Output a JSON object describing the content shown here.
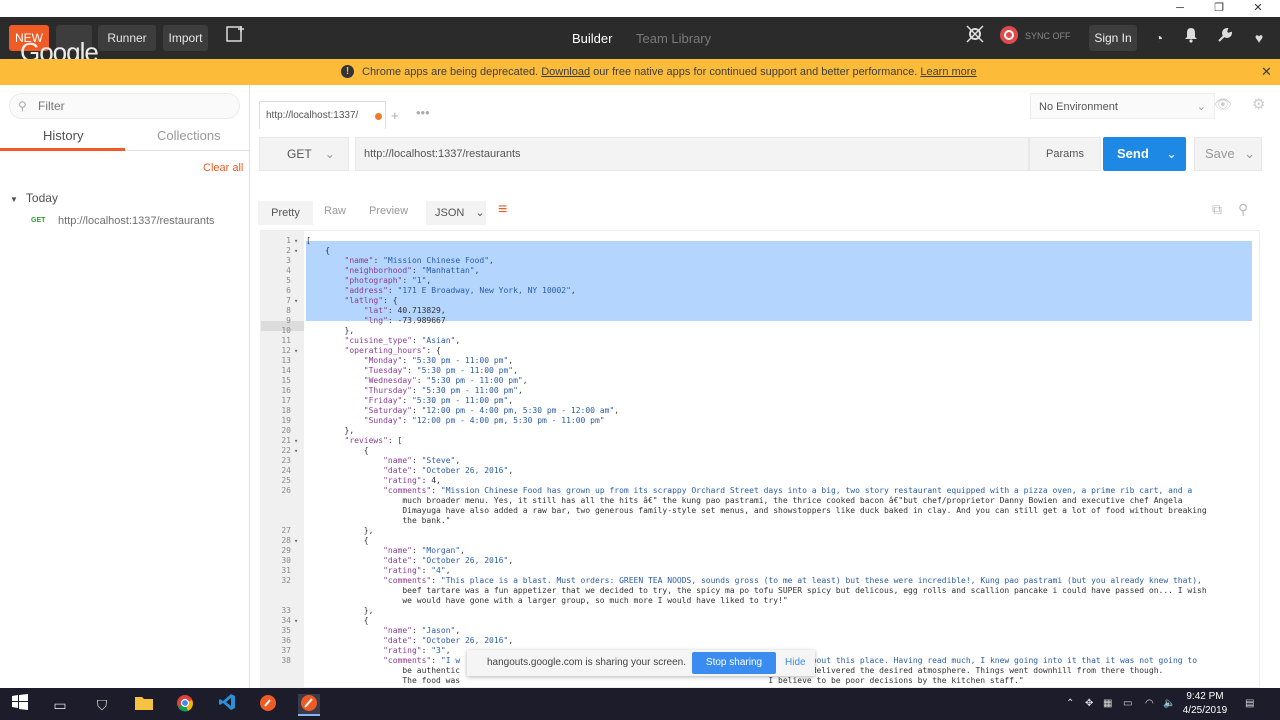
{
  "window": {
    "minimize": "─",
    "restore": "❐",
    "close": "✕"
  },
  "topbar": {
    "new_label": "NEW",
    "runner_label": "Runner",
    "import_label": "Import",
    "builder_tab": "Builder",
    "team_library_tab": "Team Library",
    "sync_label": "SYNC OFF",
    "sign_in_label": "Sign In",
    "overlay_logo": "Google"
  },
  "banner": {
    "message": "Chrome apps are being deprecated.",
    "download_link": "Download",
    "message_rest": "our free native apps for continued support and better performance.",
    "learn_more": "Learn more"
  },
  "sidebar": {
    "filter_placeholder": "Filter",
    "tabs": [
      "History",
      "Collections"
    ],
    "clear_all": "Clear all",
    "group": "Today",
    "items": [
      {
        "method": "GET",
        "url": "http://localhost:1337/restaurants"
      }
    ]
  },
  "request": {
    "tab_label": "http://localhost:1337/",
    "tab_plus": "+",
    "tab_more": "•••",
    "method": "GET",
    "url": "http://localhost:1337/restaurants",
    "params_label": "Params",
    "send_label": "Send",
    "save_label": "Save",
    "environment": "No Environment"
  },
  "response": {
    "views": [
      "Pretty",
      "Raw",
      "Preview"
    ],
    "format": "JSON"
  },
  "code_lines": [
    {
      "n": "1",
      "t": "["
    },
    {
      "n": "2",
      "t": "    {"
    },
    {
      "n": "3",
      "t": "        \"name\": \"Mission Chinese Food\","
    },
    {
      "n": "4",
      "t": "        \"neighborhood\": \"Manhattan\","
    },
    {
      "n": "5",
      "t": "        \"photograph\": \"1\","
    },
    {
      "n": "6",
      "t": "        \"address\": \"171 E Broadway, New York, NY 10002\","
    },
    {
      "n": "7",
      "t": "        \"latlng\": {"
    },
    {
      "n": "8",
      "t": "            \"lat\": 40.713829,"
    },
    {
      "n": "9",
      "t": "            \"lng\": -73.989667"
    },
    {
      "n": "10",
      "t": "        },"
    },
    {
      "n": "11",
      "t": "        \"cuisine_type\": \"Asian\","
    },
    {
      "n": "12",
      "t": "        \"operating_hours\": {"
    },
    {
      "n": "13",
      "t": "            \"Monday\": \"5:30 pm - 11:00 pm\","
    },
    {
      "n": "14",
      "t": "            \"Tuesday\": \"5:30 pm - 11:00 pm\","
    },
    {
      "n": "15",
      "t": "            \"Wednesday\": \"5:30 pm - 11:00 pm\","
    },
    {
      "n": "16",
      "t": "            \"Thursday\": \"5:30 pm - 11:00 pm\","
    },
    {
      "n": "17",
      "t": "            \"Friday\": \"5:30 pm - 11:00 pm\","
    },
    {
      "n": "18",
      "t": "            \"Saturday\": \"12:00 pm - 4:00 pm, 5:30 pm - 12:00 am\","
    },
    {
      "n": "19",
      "t": "            \"Sunday\": \"12:00 pm - 4:00 pm, 5:30 pm - 11:00 pm\""
    },
    {
      "n": "20",
      "t": "        },"
    },
    {
      "n": "21",
      "t": "        \"reviews\": ["
    },
    {
      "n": "22",
      "t": "            {"
    },
    {
      "n": "23",
      "t": "                \"name\": \"Steve\","
    },
    {
      "n": "24",
      "t": "                \"date\": \"October 26, 2016\","
    },
    {
      "n": "25",
      "t": "                \"rating\": 4,"
    },
    {
      "n": "26",
      "t": "                \"comments\": \"Mission Chinese Food has grown up from its scrappy Orchard Street days into a big, two story restaurant equipped with a pizza oven, a prime rib cart, and a"
    },
    {
      "n": "",
      "t": "                    much broader menu. Yes, it still has all the hits â€\" the kung pao pastrami, the thrice cooked bacon â€\"but chef/proprietor Danny Bowien and executive chef Angela"
    },
    {
      "n": "",
      "t": "                    Dimayuga have also added a raw bar, two generous family-style set menus, and showstoppers like duck baked in clay. And you can still get a lot of food without breaking"
    },
    {
      "n": "",
      "t": "                    the bank.\""
    },
    {
      "n": "27",
      "t": "            },"
    },
    {
      "n": "28",
      "t": "            {"
    },
    {
      "n": "29",
      "t": "                \"name\": \"Morgan\","
    },
    {
      "n": "30",
      "t": "                \"date\": \"October 26, 2016\","
    },
    {
      "n": "31",
      "t": "                \"rating\": \"4\","
    },
    {
      "n": "32",
      "t": "                \"comments\": \"This place is a blast. Must orders: GREEN TEA NOODS, sounds gross (to me at least) but these were incredible!, Kung pao pastrami (but you already knew that),"
    },
    {
      "n": "",
      "t": "                    beef tartare was a fun appetizer that we decided to try, the spicy ma po tofu SUPER spicy but delicous, egg rolls and scallion pancake i could have passed on... I wish"
    },
    {
      "n": "",
      "t": "                    we would have gone with a larger group, so much more I would have liked to try!\""
    },
    {
      "n": "33",
      "t": "            },"
    },
    {
      "n": "34",
      "t": "            {"
    },
    {
      "n": "35",
      "t": "                \"name\": \"Jason\","
    },
    {
      "n": "36",
      "t": "                \"date\": \"October 26, 2016\","
    },
    {
      "n": "37",
      "t": "                \"rating\": \"3\","
    },
    {
      "n": "38",
      "t": "                \"comments\": \"I w                                                                    ngs about this place. Having read much, I knew going into it that it was not going to"
    },
    {
      "n": "",
      "t": "                    be authentic                                                               generally delivered the desired atmosphere. Things went downhill from there though."
    },
    {
      "n": "",
      "t": "                    The food was                                                                I believe to be poor decisions by the kitchen staff.\""
    }
  ],
  "share_bar": {
    "message": "hangouts.google.com is sharing your screen.",
    "stop_label": "Stop sharing",
    "hide_label": "Hide"
  },
  "taskbar": {
    "time": "9:42 PM",
    "date": "4/25/2019"
  }
}
